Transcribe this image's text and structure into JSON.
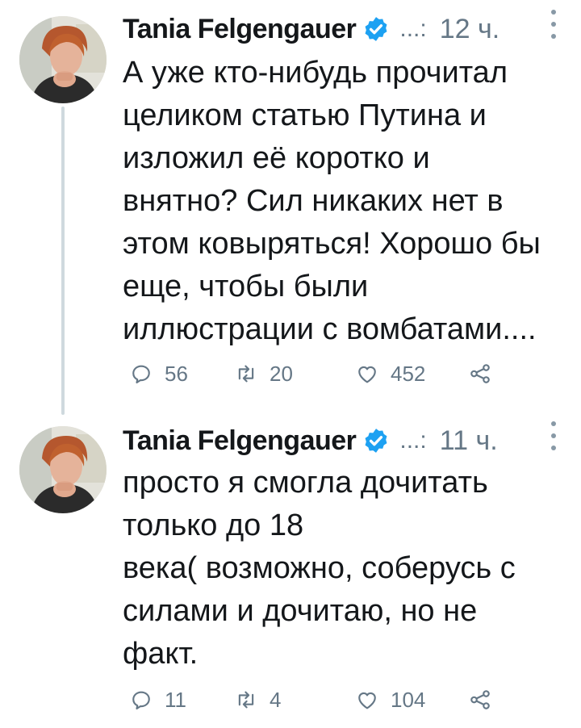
{
  "tweets": [
    {
      "author": "Tania Felgengauer",
      "handle": "...:",
      "time": "12 ч.",
      "text": "А уже кто-нибудь прочитал\nцеликом статью Путина и\nизложил её коротко и\nвнятно? Сил никаких нет в\nэтом ковыряться! Хорошо бы\nеще, чтобы были\nиллюстрации с вомбатами....",
      "replies": "56",
      "retweets": "20",
      "likes": "452"
    },
    {
      "author": "Tania Felgengauer",
      "handle": "...:",
      "time": "11 ч.",
      "text": "просто я смогла дочитать\nтолько до 18\nвека( возможно, соберусь с\nсилами и дочитаю, но не\nфакт.",
      "replies": "11",
      "retweets": "4",
      "likes": "104"
    }
  ],
  "icons": {
    "reply": "reply-icon",
    "retweet": "retweet-icon",
    "like": "like-icon",
    "share": "share-icon",
    "verified": "verified-badge-icon",
    "more": "more-options-icon"
  },
  "colors": {
    "verified": "#1da1f2",
    "muted": "#657786",
    "thread_line": "#cfd9de"
  }
}
